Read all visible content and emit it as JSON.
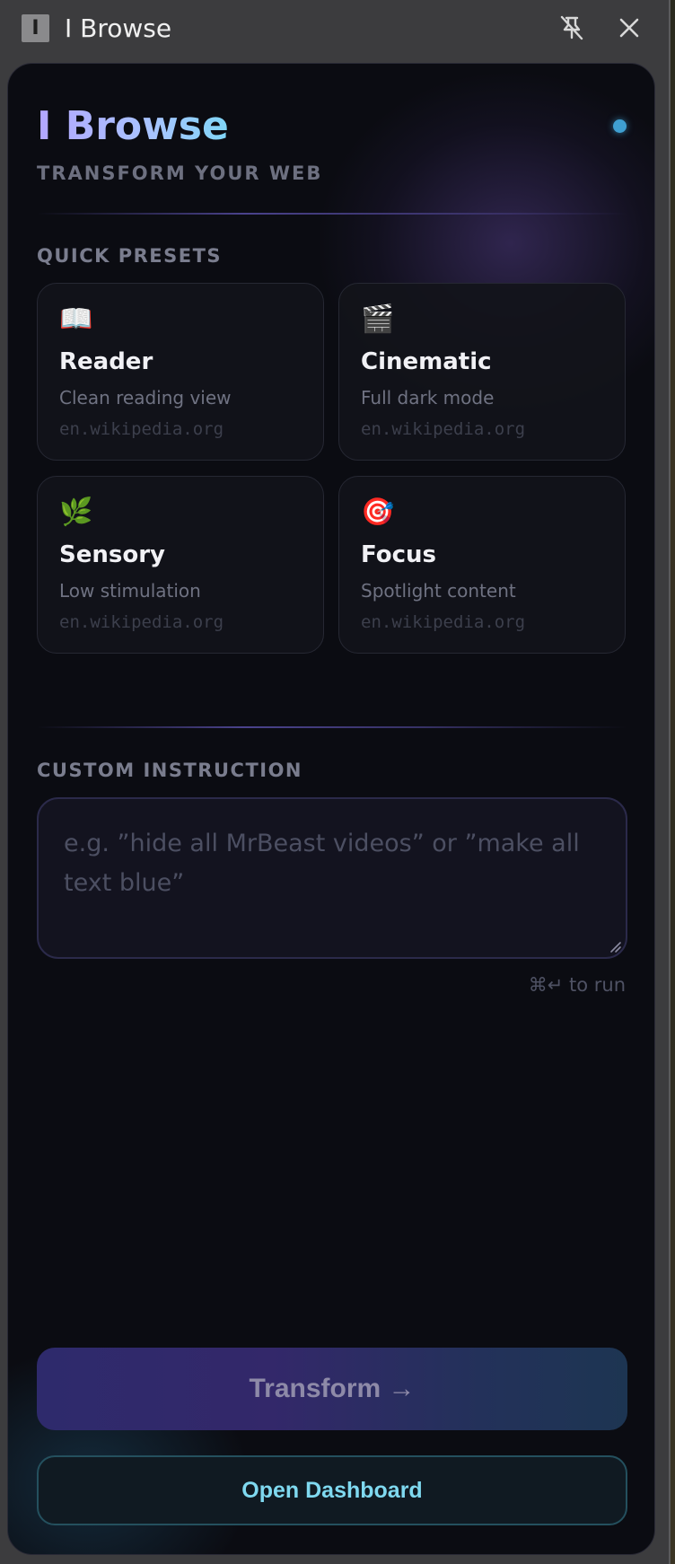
{
  "window": {
    "title": "I Browse",
    "app_icon_glyph": "I"
  },
  "header": {
    "brand": "I Browse",
    "tagline": "TRANSFORM YOUR WEB",
    "status_color": "#3f9fd1"
  },
  "presets": {
    "label": "QUICK PRESETS",
    "items": [
      {
        "emoji": "📖",
        "icon": "open-book-icon",
        "title": "Reader",
        "desc": "Clean reading view",
        "host": "en.wikipedia.org"
      },
      {
        "emoji": "🎬",
        "icon": "clapper-board-icon",
        "title": "Cinematic",
        "desc": "Full dark mode",
        "host": "en.wikipedia.org"
      },
      {
        "emoji": "🌿",
        "icon": "herb-icon",
        "title": "Sensory",
        "desc": "Low stimulation",
        "host": "en.wikipedia.org"
      },
      {
        "emoji": "🎯",
        "icon": "target-icon",
        "title": "Focus",
        "desc": "Spotlight content",
        "host": "en.wikipedia.org"
      }
    ]
  },
  "custom": {
    "label": "CUSTOM INSTRUCTION",
    "placeholder": "e.g. ”hide all MrBeast videos” or ”make all text blue”",
    "value": "",
    "hint": "⌘↵ to run"
  },
  "actions": {
    "transform_label": "Transform →",
    "dashboard_label": "Open Dashboard"
  }
}
